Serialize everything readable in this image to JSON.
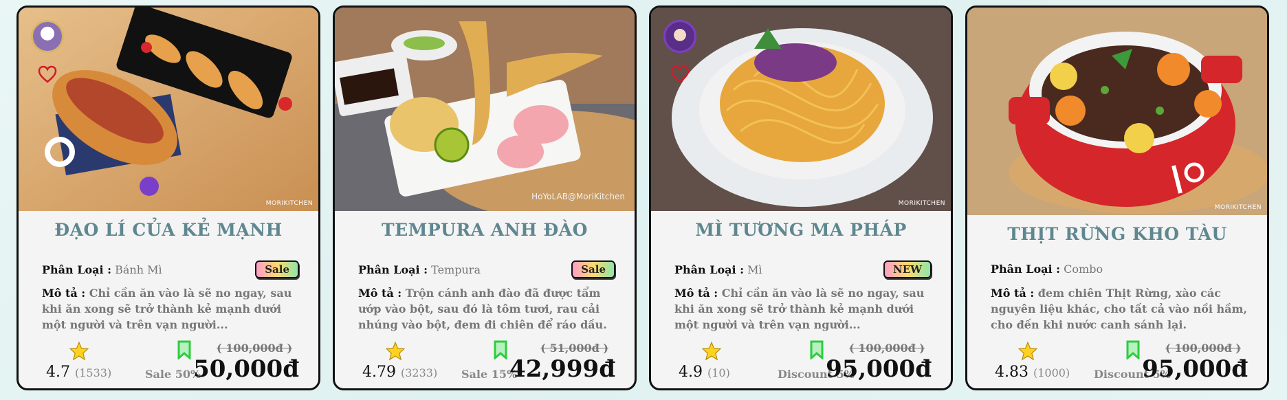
{
  "cards": [
    {
      "title": "ĐẠO LÍ CỦA KẺ MẠNH",
      "category_label": "Phân Loại :",
      "category": "Bánh Mì",
      "badge": "Sale",
      "desc_label": "Mô tả :",
      "desc": "Chỉ cần ăn vào là sẽ no ngay, sau khi ăn xong sẽ trở thành kẻ mạnh dưới một người và trên vạn người...",
      "rating": "4.7",
      "count": "(1533)",
      "promo": "Sale 50%",
      "old_price": "( 100,000đ )",
      "price": "50,000đ",
      "watermark": "MORIKITCHEN",
      "has_avatar": true
    },
    {
      "title": "TEMPURA ANH ĐÀO",
      "category_label": "Phân Loại :",
      "category": "Tempura",
      "badge": "Sale",
      "desc_label": "Mô tả :",
      "desc": "Trộn cánh anh đào đã được tẩm ướp vào bột, sau đó là tôm tươi, rau cải nhúng vào bột, đem đi chiên để ráo dầu.",
      "rating": "4.79",
      "count": "(3233)",
      "promo": "Sale 15%",
      "old_price": "( 51,000đ )",
      "price": "42,999đ",
      "watermark": "HoYoLAB@MoriKitchen",
      "has_avatar": false
    },
    {
      "title": "MÌ TƯƠNG MA PHÁP",
      "category_label": "Phân Loại :",
      "category": "Mì",
      "badge": "NEW",
      "desc_label": "Mô tả :",
      "desc": "Chỉ cần ăn vào là sẽ no ngay, sau khi ăn xong sẽ trở thành kẻ mạnh dưới một người và trên vạn người...",
      "rating": "4.9",
      "count": "(10)",
      "promo": "Discount 5%",
      "old_price": "( 100,000đ )",
      "price": "95,000đ",
      "watermark": "MORIKITCHEN",
      "has_avatar": true
    },
    {
      "title": "THỊT RỪNG KHO TÀU",
      "category_label": "Phân Loại :",
      "category": "Combo",
      "badge": "",
      "desc_label": "Mô tả :",
      "desc": "đem chiên Thịt Rừng, xào các nguyên liệu khác, cho tất cả vào nồi hầm, cho đến khi nước canh sánh lại.",
      "rating": "4.83",
      "count": "(1000)",
      "promo": "Discount 5%",
      "old_price": "( 100,000đ )",
      "price": "95,000đ",
      "watermark": "MORIKITCHEN",
      "has_avatar": false
    }
  ],
  "colors": {
    "title": "#5f8790",
    "border": "#111111",
    "badge_gradient": [
      "#ff9ec8",
      "#ffd86e",
      "#8ee6a8"
    ],
    "star": "#ffd21f",
    "bookmark": "#2ecc40",
    "heart": "#d11a2a"
  },
  "icons": [
    "avatar",
    "heart-icon",
    "star-icon",
    "bookmark-icon"
  ]
}
